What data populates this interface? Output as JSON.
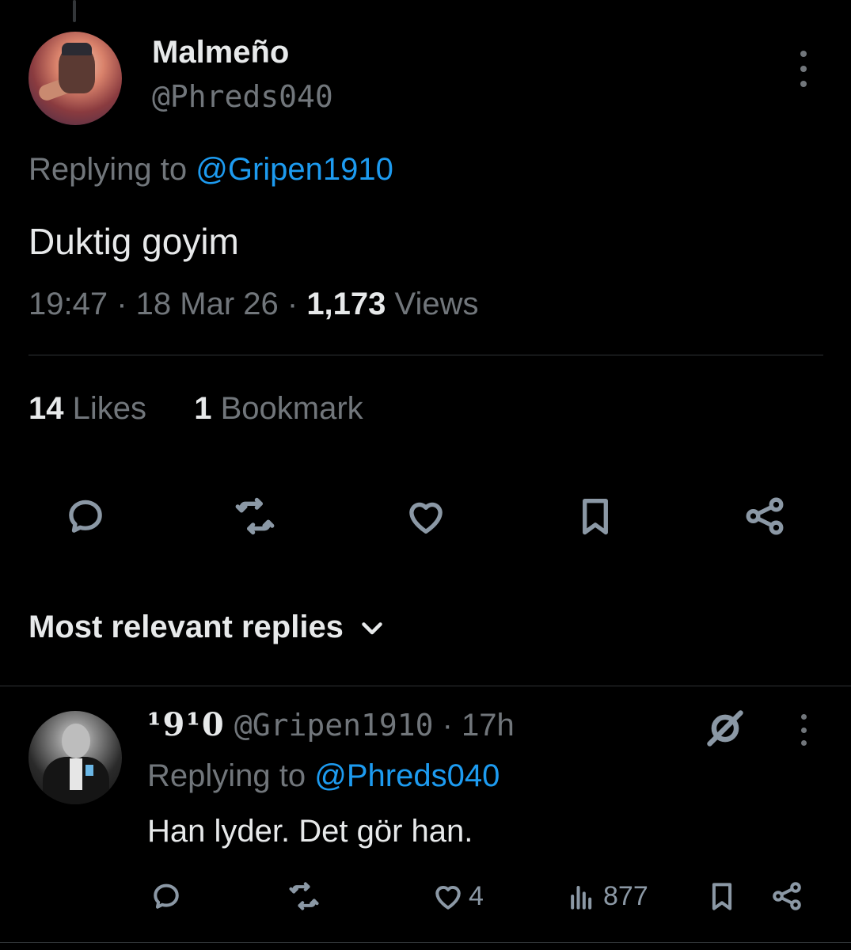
{
  "tweet": {
    "author_name": "Malmeño",
    "author_handle": "@Phreds040",
    "replying_prefix": "Replying to ",
    "replying_to": "@Gripen1910",
    "text": "Duktig goyim",
    "time": "19:47",
    "date": "18 Mar 26",
    "separator": " · ",
    "views_count": "1,173",
    "views_label": " Views",
    "likes_count": "14",
    "likes_label": " Likes",
    "bookmarks_count": "1",
    "bookmarks_label": " Bookmark",
    "action_icons": [
      "reply-icon",
      "retweet-icon",
      "like-icon",
      "bookmark-icon",
      "share-icon"
    ]
  },
  "replies_sort": {
    "label": "Most relevant replies",
    "icon": "chevron-down-icon"
  },
  "reply": {
    "author_name": "¹9¹0",
    "author_handle": "@Gripen1910",
    "time_sep": " · ",
    "time": "17h",
    "replying_prefix": "Replying to ",
    "replying_to": "@Phreds040",
    "text": "Han lyder. Det gör han.",
    "likes": "4",
    "views": "877"
  },
  "colors": {
    "background": "#000000",
    "text": "#e7e9ea",
    "muted": "#71767b",
    "accent": "#1d9bf0",
    "icon": "#8b98a5"
  }
}
